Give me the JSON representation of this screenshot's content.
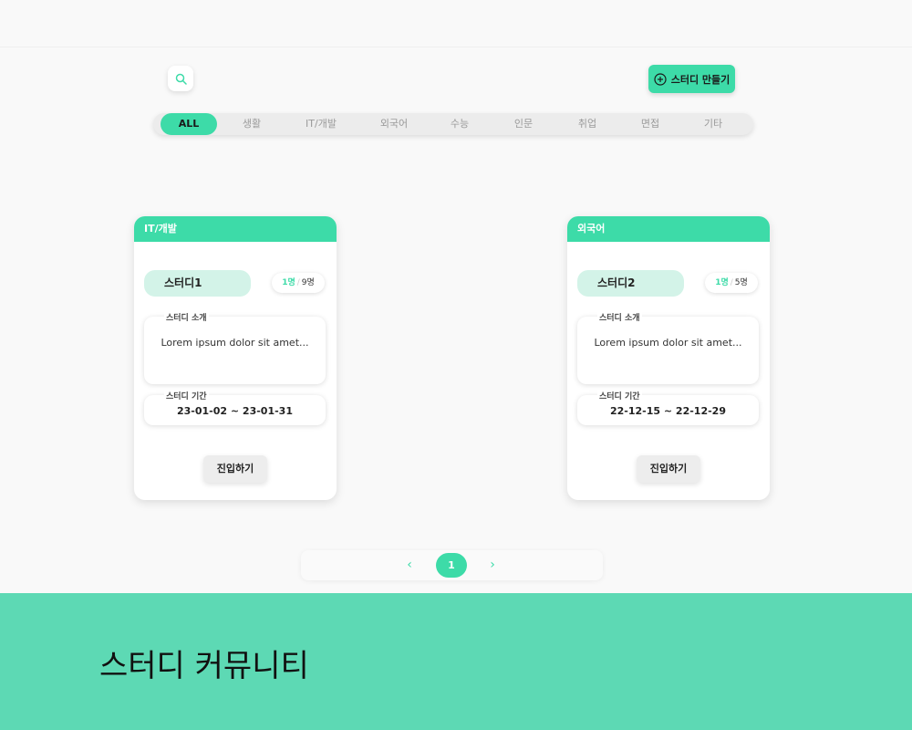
{
  "header": {
    "search_icon": "search-icon",
    "create_button": {
      "icon": "plus-circle-icon",
      "label": "스터디 만들기"
    }
  },
  "categories": [
    {
      "label": "ALL",
      "active": true
    },
    {
      "label": "생활",
      "active": false
    },
    {
      "label": "IT/개발",
      "active": false
    },
    {
      "label": "외국어",
      "active": false
    },
    {
      "label": "수능",
      "active": false
    },
    {
      "label": "인문",
      "active": false
    },
    {
      "label": "취업",
      "active": false
    },
    {
      "label": "면접",
      "active": false
    },
    {
      "label": "기타",
      "active": false
    }
  ],
  "cards": [
    {
      "category": "IT/개발",
      "name": "스터디1",
      "current": "1명",
      "max": "9명",
      "intro_label": "스터디 소개",
      "intro": "Lorem ipsum dolor sit amet...",
      "period_label": "스터디 기간",
      "period": "23-01-02 ~ 23-01-31",
      "enter_label": "진입하기"
    },
    {
      "category": "외국어",
      "name": "스터디2",
      "current": "1명",
      "max": "5명",
      "intro_label": "스터디 소개",
      "intro": "Lorem ipsum dolor sit amet...",
      "period_label": "스터디 기간",
      "period": "22-12-15 ~ 22-12-29",
      "enter_label": "진입하기"
    }
  ],
  "pagination": {
    "prev_icon": "chevron-left-icon",
    "next_icon": "chevron-right-icon",
    "current_page": "1"
  },
  "footer": {
    "title": "스터디 커뮤니티"
  },
  "colors": {
    "accent": "#3ddba8",
    "footer": "#5dd9b4",
    "pill": "#d3f3e8"
  }
}
